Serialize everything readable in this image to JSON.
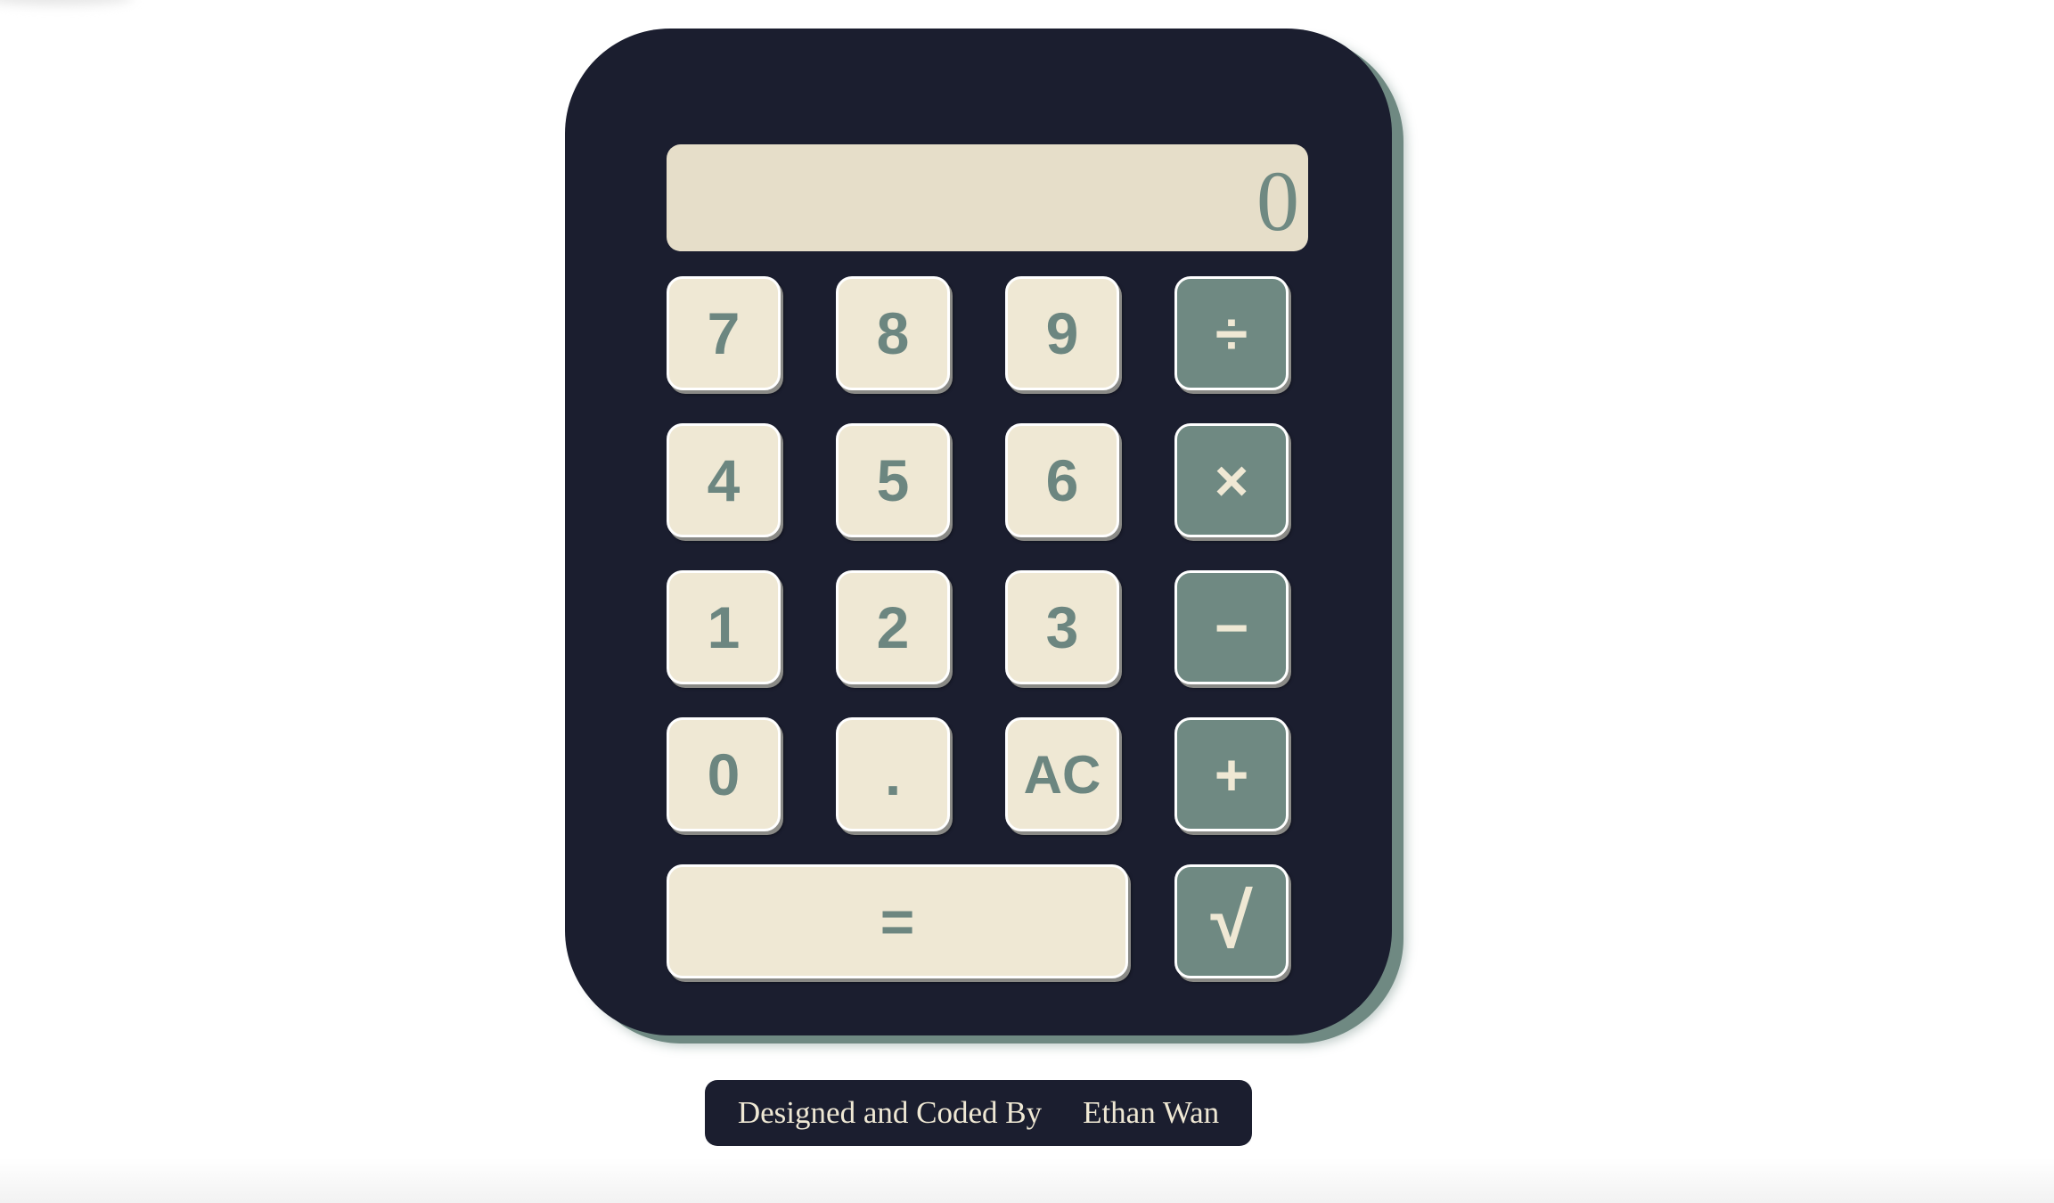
{
  "calculator": {
    "display": "0",
    "keys": {
      "seven": "7",
      "eight": "8",
      "nine": "9",
      "divide": "÷",
      "four": "4",
      "five": "5",
      "six": "6",
      "multiply": "×",
      "one": "1",
      "two": "2",
      "three": "3",
      "subtract": "−",
      "zero": "0",
      "decimal": ".",
      "clear": "AC",
      "add": "+",
      "equals": "=",
      "sqrt": "√"
    }
  },
  "footer": {
    "prefix": "Designed and Coded By",
    "author": "Ethan Wan"
  },
  "colors": {
    "body": "#1b1e2f",
    "display": "#e6dec9",
    "key": "#efe8d4",
    "operator_key": "#6f8982",
    "key_text": "#6c8680"
  }
}
